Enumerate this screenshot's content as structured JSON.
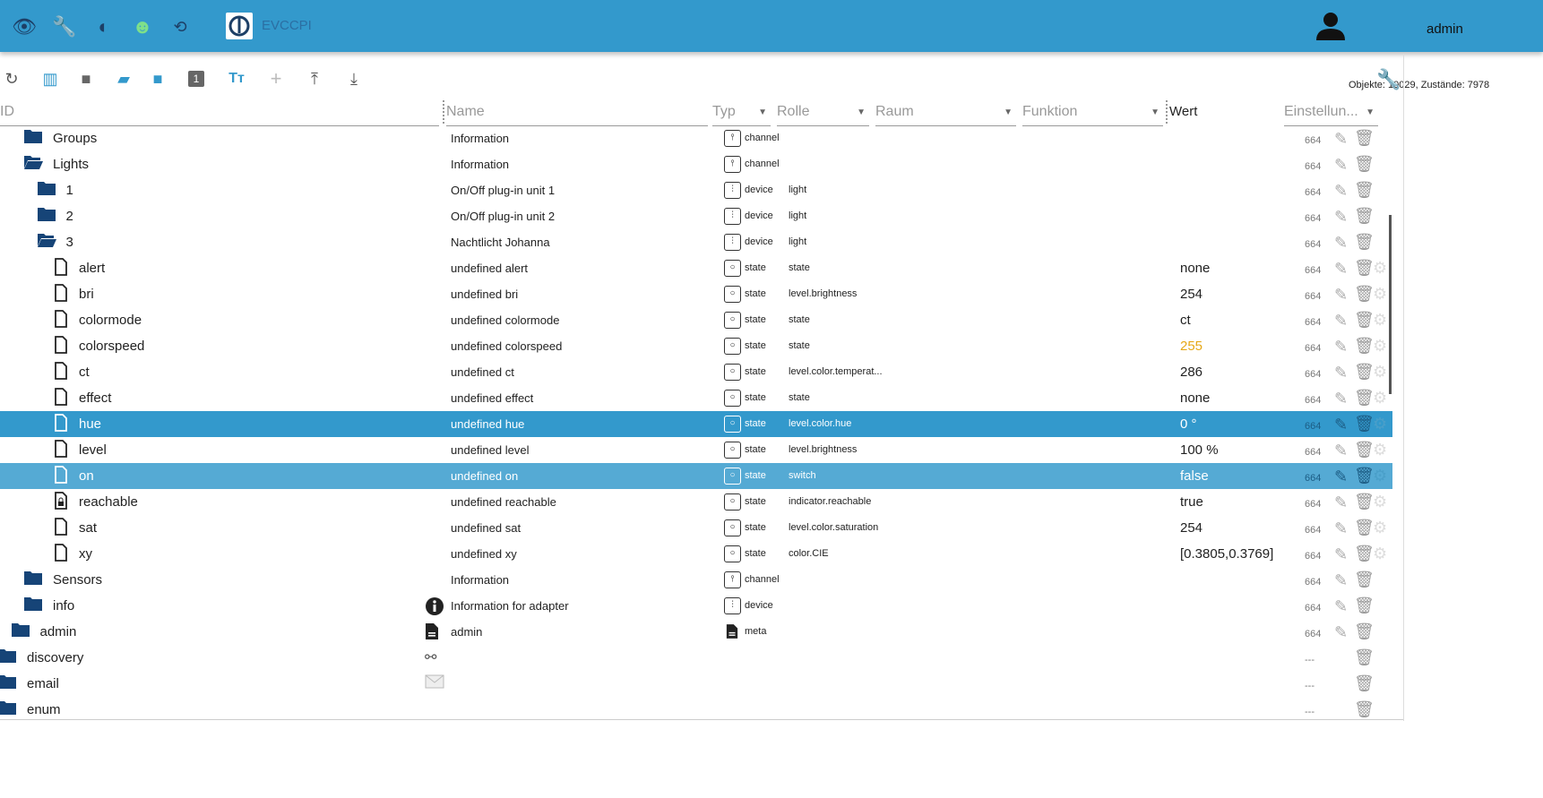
{
  "header": {
    "app_label": "EVCCPI",
    "user": "admin",
    "icons": [
      "eye-icon",
      "wrench-icon",
      "brightness-icon",
      "head-icon",
      "sync-disabled-icon"
    ]
  },
  "toolbar": {
    "stats": "Objekte: 10029, Zustände: 7978",
    "icons": [
      "refresh-icon",
      "columns-icon",
      "folder-closed-icon",
      "folder-open-icon",
      "folder-icon",
      "one-icon",
      "text-size-icon",
      "add-icon",
      "upload-icon",
      "download-icon"
    ]
  },
  "columns": {
    "id": "ID",
    "name": "Name",
    "type": "Typ",
    "role": "Rolle",
    "room": "Raum",
    "function": "Funktion",
    "value": "Wert",
    "settings": "Einstellun..."
  },
  "colors": {
    "header": "#3399cc",
    "folder": "#164477",
    "selected": "#3399cc",
    "selected2": "#55aad4",
    "value_ack_false": "#e6a817"
  },
  "rows": [
    {
      "level": 2,
      "icon": "folder",
      "id": "Groups",
      "name": "Information",
      "type": "channel",
      "role": "",
      "value": "",
      "acl": "664"
    },
    {
      "level": 2,
      "icon": "folder-open",
      "id": "Lights",
      "name": "Information",
      "type": "channel",
      "role": "",
      "value": "",
      "acl": "664"
    },
    {
      "level": 3,
      "icon": "folder",
      "id": "1",
      "name": "On/Off plug-in unit 1",
      "type": "device",
      "role": "light",
      "value": "",
      "acl": "664"
    },
    {
      "level": 3,
      "icon": "folder",
      "id": "2",
      "name": "On/Off plug-in unit 2",
      "type": "device",
      "role": "light",
      "value": "",
      "acl": "664"
    },
    {
      "level": 3,
      "icon": "folder-open",
      "id": "3",
      "name": "Nachtlicht Johanna",
      "type": "device",
      "role": "light",
      "value": "",
      "acl": "664"
    },
    {
      "level": 4,
      "icon": "file",
      "id": "alert",
      "name": "undefined alert",
      "type": "state",
      "role": "state",
      "value": "none",
      "acl": "664"
    },
    {
      "level": 4,
      "icon": "file",
      "id": "bri",
      "name": "undefined bri",
      "type": "state",
      "role": "level.brightness",
      "value": "254",
      "acl": "664"
    },
    {
      "level": 4,
      "icon": "file",
      "id": "colormode",
      "name": "undefined colormode",
      "type": "state",
      "role": "state",
      "value": "ct",
      "acl": "664"
    },
    {
      "level": 4,
      "icon": "file",
      "id": "colorspeed",
      "name": "undefined colorspeed",
      "type": "state",
      "role": "state",
      "value": "255",
      "value_color": "#e6a817",
      "acl": "664"
    },
    {
      "level": 4,
      "icon": "file",
      "id": "ct",
      "name": "undefined ct",
      "type": "state",
      "role": "level.color.temperat...",
      "value": "286",
      "acl": "664"
    },
    {
      "level": 4,
      "icon": "file",
      "id": "effect",
      "name": "undefined effect",
      "type": "state",
      "role": "state",
      "value": "none",
      "acl": "664"
    },
    {
      "level": 4,
      "icon": "file",
      "id": "hue",
      "name": "undefined hue",
      "type": "state",
      "role": "level.color.hue",
      "value": "0 °",
      "acl": "664",
      "selected": 1
    },
    {
      "level": 4,
      "icon": "file",
      "id": "level",
      "name": "undefined level",
      "type": "state",
      "role": "level.brightness",
      "value": "100 %",
      "acl": "664"
    },
    {
      "level": 4,
      "icon": "file",
      "id": "on",
      "name": "undefined on",
      "type": "state",
      "role": "switch",
      "value": "false",
      "acl": "664",
      "selected": 2
    },
    {
      "level": 4,
      "icon": "file-lock",
      "id": "reachable",
      "name": "undefined reachable",
      "type": "state",
      "role": "indicator.reachable",
      "value": "true",
      "acl": "664"
    },
    {
      "level": 4,
      "icon": "file",
      "id": "sat",
      "name": "undefined sat",
      "type": "state",
      "role": "level.color.saturation",
      "value": "254",
      "acl": "664"
    },
    {
      "level": 4,
      "icon": "file",
      "id": "xy",
      "name": "undefined xy",
      "type": "state",
      "role": "color.CIE",
      "value": "[0.3805,0.3769]",
      "acl": "664"
    },
    {
      "level": 2,
      "icon": "folder",
      "id": "Sensors",
      "name": "Information",
      "type": "channel",
      "role": "",
      "value": "",
      "acl": "664"
    },
    {
      "level": 2,
      "icon": "folder",
      "id": "info",
      "name": "Information for adapter",
      "name_icon": "info",
      "type": "device",
      "role": "",
      "value": "",
      "acl": "664"
    },
    {
      "level": 1,
      "icon": "folder",
      "id": "admin",
      "name": "admin",
      "name_icon": "doc",
      "type": "meta",
      "role": "",
      "value": "",
      "acl": "664"
    },
    {
      "level": 0,
      "icon": "folder",
      "id": "discovery",
      "name": "",
      "name_icon": "binoculars",
      "type": "",
      "role": "",
      "value": "",
      "acl": "---"
    },
    {
      "level": 0,
      "icon": "folder",
      "id": "email",
      "name": "",
      "name_icon": "mail",
      "type": "",
      "role": "",
      "value": "",
      "acl": "---"
    },
    {
      "level": 0,
      "icon": "folder",
      "id": "enum",
      "name": "",
      "type": "",
      "role": "",
      "value": "",
      "acl": "---"
    }
  ]
}
